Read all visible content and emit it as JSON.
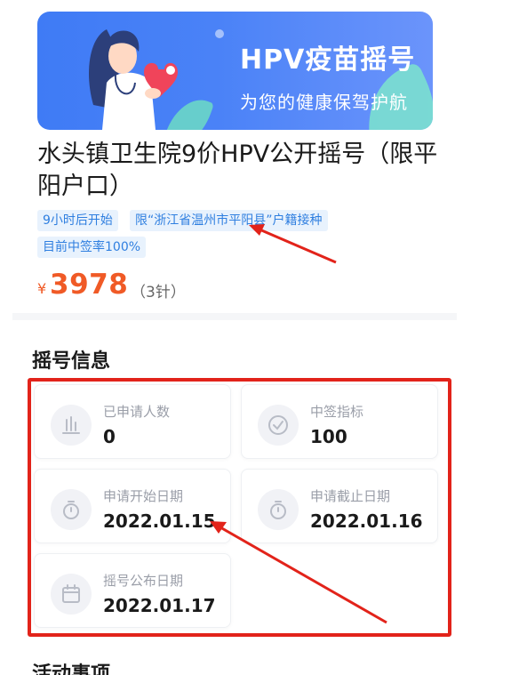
{
  "banner": {
    "title": "HPV疫苗摇号",
    "subtitle": "为您的健康保驾护航",
    "colors": {
      "background": "#4a82f7",
      "accent_leaf": "#7be0cf",
      "heart": "#f0445a"
    }
  },
  "event": {
    "title": "水头镇卫生院9价HPV公开摇号（限平阳户口）",
    "tags": [
      "9小时后开始",
      "限“浙江省温州市平阳县”户籍接种",
      "目前中签率100%"
    ],
    "price_symbol": "¥",
    "price": "3978",
    "price_note": "（3针）",
    "price_color": "#f05a26"
  },
  "lottery_info": {
    "section_title": "摇号信息",
    "cards": [
      {
        "label": "已申请人数",
        "value": "0",
        "icon": "bar-chart-icon"
      },
      {
        "label": "中签指标",
        "value": "100",
        "icon": "check-circle-icon"
      },
      {
        "label": "申请开始日期",
        "value": "2022.01.15",
        "icon": "stopwatch-icon"
      },
      {
        "label": "申请截止日期",
        "value": "2022.01.16",
        "icon": "stopwatch-icon"
      },
      {
        "label": "摇号公布日期",
        "value": "2022.01.17",
        "icon": "calendar-icon"
      }
    ]
  },
  "next_section": {
    "title": "活动事项"
  },
  "annotation_color": "#e2231a"
}
